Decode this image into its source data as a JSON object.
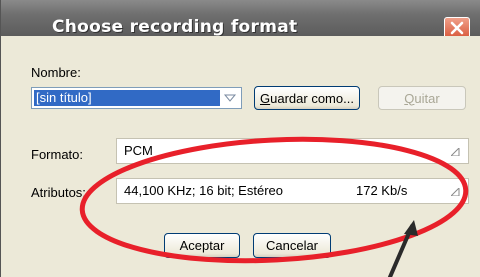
{
  "dialog": {
    "title": "Choose recording format",
    "close_icon": "close-icon"
  },
  "name_section": {
    "label": "Nombre:",
    "selected_value": "[sin título]",
    "save_as_label_u": "G",
    "save_as_label_rest": "uardar como...",
    "remove_label_u": "Q",
    "remove_label_rest": "uitar"
  },
  "format_section": {
    "label": "Formato:",
    "value": "PCM"
  },
  "attributes_section": {
    "label": "Atributos:",
    "value": "44,100 KHz; 16 bit; Estéreo",
    "rate": "172 Kb/s"
  },
  "buttons": {
    "ok_label": "Aceptar",
    "cancel_label": "Cancelar"
  },
  "annotation": {
    "color": "#e8202a"
  }
}
